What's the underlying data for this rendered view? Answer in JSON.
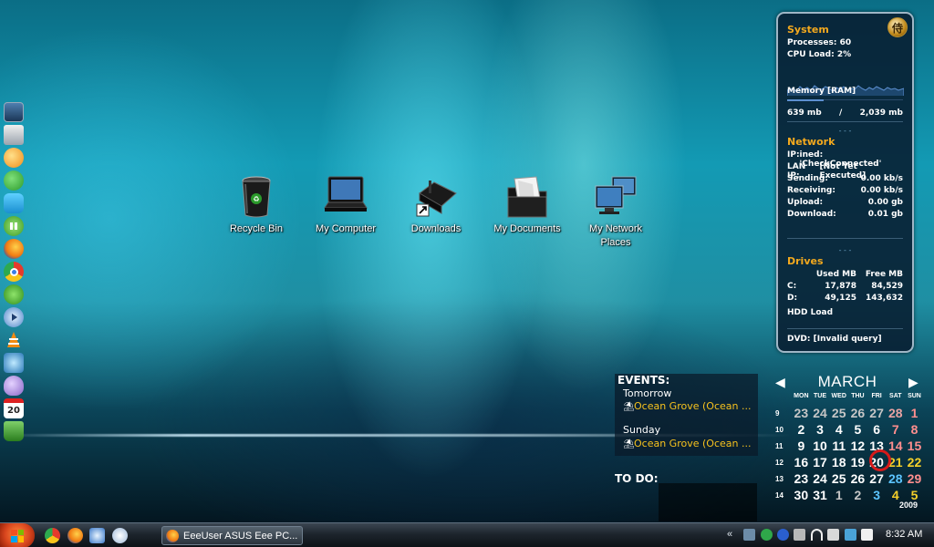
{
  "desktop_icons": [
    {
      "label": "Recycle Bin",
      "icon": "recycle-bin-icon"
    },
    {
      "label": "My Computer",
      "icon": "laptop-icon"
    },
    {
      "label": "Downloads",
      "icon": "downloads-folder-icon"
    },
    {
      "label": "My Documents",
      "icon": "documents-folder-icon"
    },
    {
      "label": "My Network Places",
      "icon": "network-icon"
    }
  ],
  "dock": [
    "laptop-icon",
    "mail-icon",
    "messenger-icon",
    "skype-icon",
    "windows-live-icon",
    "pause-icon",
    "firefox-icon",
    "chrome-icon",
    "utorrent-icon",
    "media-player-icon",
    "vlc-icon",
    "network-share-icon",
    "pidgin-icon",
    "calendar-icon",
    "trash-icon"
  ],
  "dock_calendar_text": "20",
  "system": {
    "title": "System",
    "processes_label": "Processes:",
    "processes_value": "60",
    "cpu_label": "CPU Load:",
    "cpu_value": "2%",
    "memory_label": "Memory [RAM]",
    "memory_used": "639 mb",
    "memory_sep": "/",
    "memory_total": "2,039 mb",
    "network_title": "Network",
    "ip_label": "IP:",
    "ip_value": "ined: 'CheckConnected'",
    "lanip_label": "LAN IP:",
    "lanip_value": "[Not Yet Executed]",
    "sending_label": "Sending:",
    "sending_value": "0.00 kb/s",
    "receiving_label": "Receiving:",
    "receiving_value": "0.00 kb/s",
    "upload_label": "Upload:",
    "upload_value": "0.00 gb",
    "download_label": "Download:",
    "download_value": "0.01 gb",
    "drives_title": "Drives",
    "used_header": "Used MB",
    "free_header": "Free MB",
    "drives": [
      {
        "name": "C:",
        "used": "17,878",
        "free": "84,529"
      },
      {
        "name": "D:",
        "used": "49,125",
        "free": "143,632"
      }
    ],
    "hdd_label": "HDD Load",
    "dvd_label": "DVD: [Invalid query]",
    "dots": "- - -",
    "logo_text": "侍"
  },
  "events": {
    "title": "EVENTS:",
    "items": [
      {
        "day": "Tomorrow",
        "text": "Ocean Grove (Ocean ..."
      },
      {
        "day": "Sunday",
        "text": "Ocean Grove (Ocean ..."
      }
    ],
    "todo_title": "TO DO:"
  },
  "calendar": {
    "month": "MARCH",
    "year": "2009",
    "prev_arrow": "◀",
    "next_arrow": "▶",
    "days_of_week": [
      "MON",
      "TUE",
      "WED",
      "THU",
      "FRI",
      "SAT",
      "SUN"
    ],
    "weeks": [
      {
        "num": "9",
        "days": [
          "23",
          "24",
          "25",
          "26",
          "27",
          "28",
          "1"
        ]
      },
      {
        "num": "10",
        "days": [
          "2",
          "3",
          "4",
          "5",
          "6",
          "7",
          "8"
        ]
      },
      {
        "num": "11",
        "days": [
          "9",
          "10",
          "11",
          "12",
          "13",
          "14",
          "15"
        ]
      },
      {
        "num": "12",
        "days": [
          "16",
          "17",
          "18",
          "19",
          "20",
          "21",
          "22"
        ]
      },
      {
        "num": "13",
        "days": [
          "23",
          "24",
          "25",
          "26",
          "27",
          "28",
          "29"
        ]
      },
      {
        "num": "14",
        "days": [
          "30",
          "31",
          "1",
          "2",
          "3",
          "4",
          "5"
        ]
      }
    ],
    "today": "20"
  },
  "taskbar": {
    "task_label": "EeeUser ASUS Eee PC...",
    "tray_chevron": "«",
    "clock": "8:32 AM"
  }
}
